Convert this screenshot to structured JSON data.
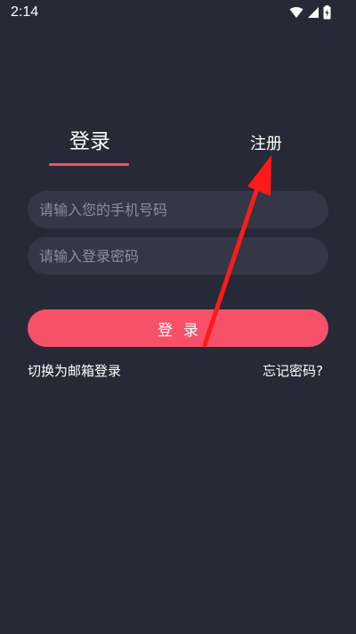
{
  "status_bar": {
    "time": "2:14",
    "icons": [
      "wifi-icon",
      "signal-icon",
      "battery-icon"
    ]
  },
  "tabs": {
    "login_label": "登录",
    "register_label": "注册",
    "active": "login"
  },
  "form": {
    "phone_placeholder": "请输入您的手机号码",
    "password_placeholder": "请输入登录密码",
    "submit_label": "登录"
  },
  "links": {
    "switch_to_email": "切换为邮箱登录",
    "forgot_password": "忘记密码?"
  },
  "colors": {
    "background": "#272a36",
    "input_background": "#343745",
    "accent": "#f65169",
    "annotation_arrow": "#ff1a1a"
  }
}
